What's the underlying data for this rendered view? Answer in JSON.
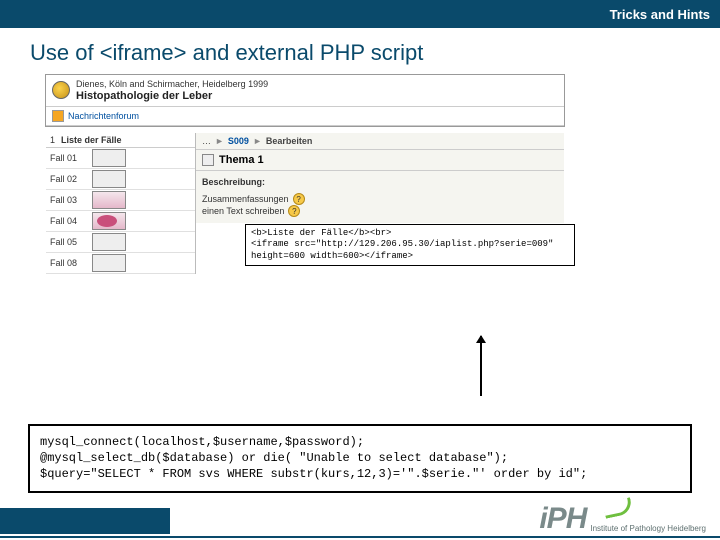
{
  "topbar": {
    "label": "Tricks and Hints"
  },
  "title": "Use of <iframe> and external PHP script",
  "app": {
    "byline": "Dienes, Köln and Schirmacher, Heidelberg 1999",
    "heading": "Histopathologie der Leber",
    "news_link": "Nachrichtenforum",
    "side_num": "1",
    "side_title": "Liste der Fälle",
    "cases": [
      "Fall 01",
      "Fall 02",
      "Fall 03",
      "Fall 04",
      "Fall 05",
      "Fall 08"
    ],
    "crumb_s": "S009",
    "crumb_action": "Bearbeiten",
    "thema": "Thema 1",
    "beschr_label": "Beschreibung:",
    "extra1": "Zusammenfassungen",
    "extra2": "einen Text schreiben"
  },
  "callout": "<b>Liste der Fälle</b><br>\n<iframe src=\"http://129.206.95.30/iaplist.php?serie=009\"\nheight=600 width=600></iframe>",
  "php": {
    "l1": "mysql_connect(localhost,$username,$password);",
    "l2": "@mysql_select_db($database) or die( \"Unable to select database\");",
    "l3": "$query=\"SELECT * FROM svs WHERE substr(kurs,12,3)='\".$serie.\"' order by id\";"
  },
  "footer": {
    "brand": "iPH",
    "sub": "Institute of Pathology Heidelberg"
  }
}
